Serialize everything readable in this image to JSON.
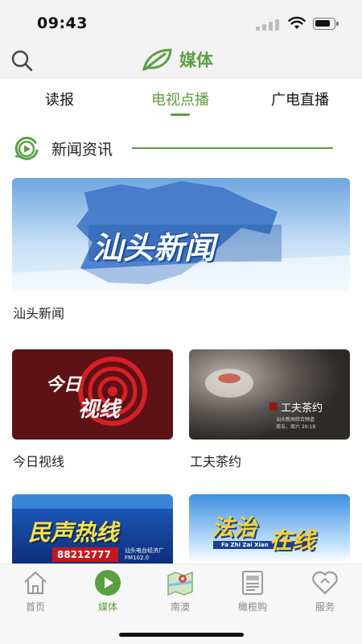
{
  "status_bar": {
    "time": "09:43"
  },
  "header": {
    "title": "媒体"
  },
  "tabs": [
    {
      "label": "读报",
      "active": false
    },
    {
      "label": "电视点播",
      "active": true
    },
    {
      "label": "广电直播",
      "active": false
    }
  ],
  "section": {
    "title": "新闻资讯"
  },
  "cards": [
    {
      "label": "汕头新闻",
      "thumb_title": "汕头新闻"
    },
    {
      "label": "今日视线",
      "thumb_title_line1": "今日",
      "thumb_title_line2": "视线"
    },
    {
      "label": "工夫茶约",
      "thumb_title": "工夫茶约",
      "thumb_caption_line1": "汕头新闻综合频道",
      "thumb_caption_line2": "周五、周六 20:18"
    },
    {
      "thumb_title": "民声热线",
      "thumb_phone": "88212777",
      "thumb_caption": "汕头电台经济广 FM102.0"
    },
    {
      "thumb_title_line1": "法治",
      "thumb_title_line2": "在线",
      "thumb_pinyin": "Fa Zhi Zai Xian"
    }
  ],
  "tabbar": [
    {
      "label": "首页",
      "icon": "home-icon",
      "active": false
    },
    {
      "label": "媒体",
      "icon": "play-icon",
      "active": true
    },
    {
      "label": "南澳",
      "icon": "map-icon",
      "active": false
    },
    {
      "label": "橄榄购",
      "icon": "newspaper-icon",
      "active": false
    },
    {
      "label": "服务",
      "icon": "heart-icon",
      "active": false
    }
  ],
  "colors": {
    "accent": "#5aa041",
    "header_bg": "#f2f2f2"
  }
}
